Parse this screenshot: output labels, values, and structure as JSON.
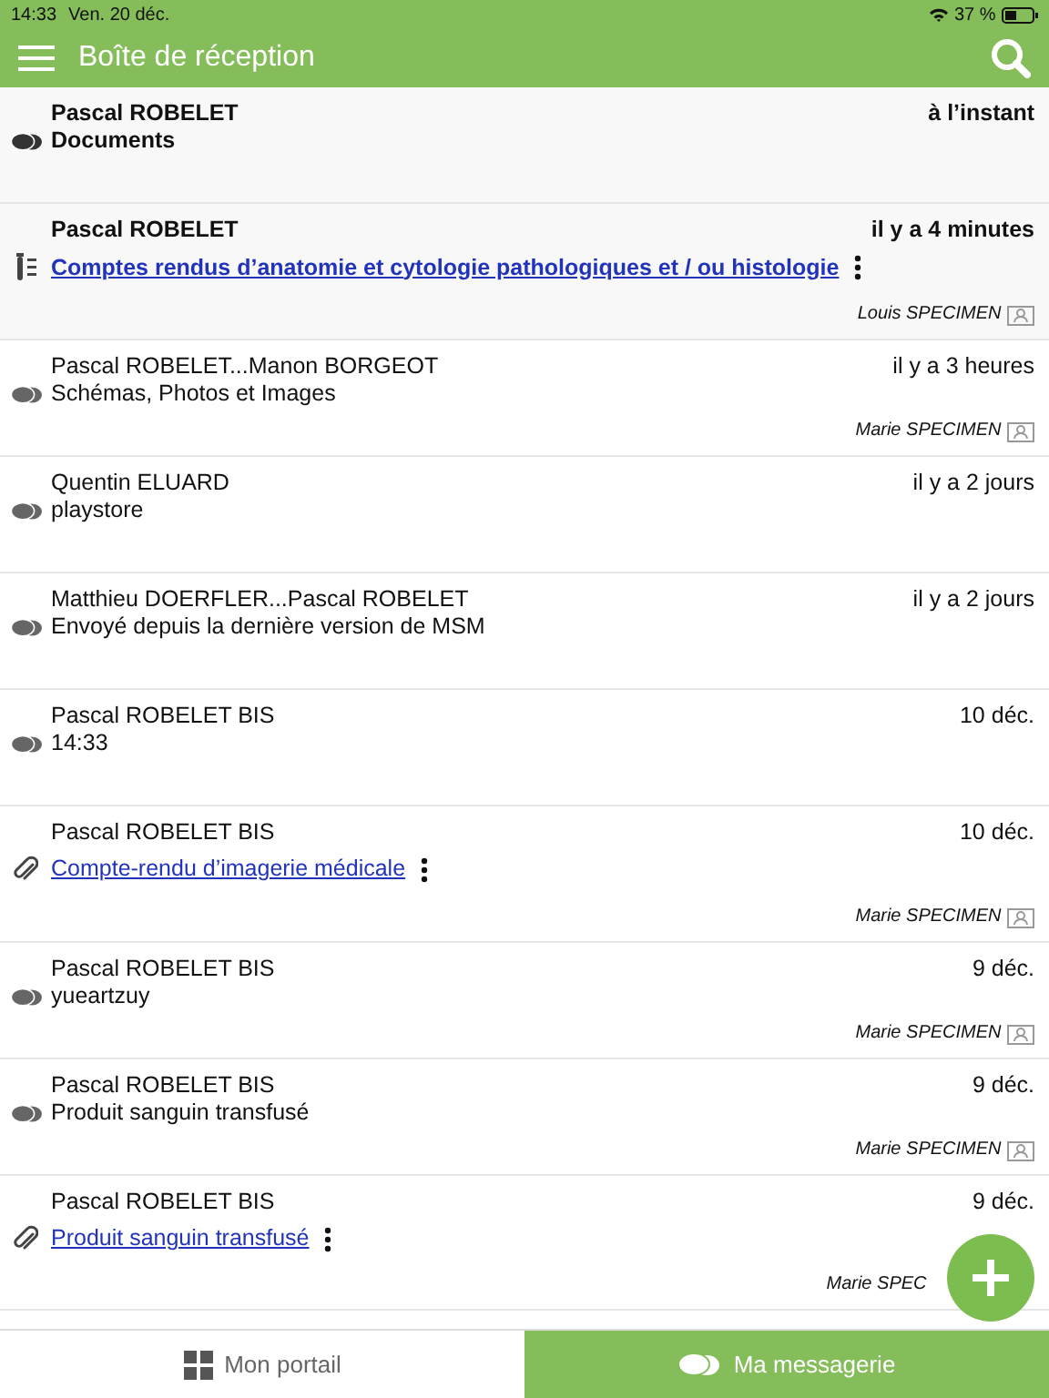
{
  "status_bar": {
    "time": "14:33",
    "date": "Ven. 20 déc.",
    "battery": "37 %"
  },
  "header": {
    "title": "Boîte de réception"
  },
  "messages": [
    {
      "kind": "message",
      "unread": true,
      "sender": "Pascal ROBELET",
      "time": "à l’instant",
      "subject": "Documents"
    },
    {
      "kind": "lab_report",
      "unread": true,
      "sender": "Pascal ROBELET",
      "time": "il y a 4 minutes",
      "subject": "Comptes rendus d’anatomie et cytologie pathologiques et / ou histologie",
      "patient": "Louis SPECIMEN",
      "patient_card": true
    },
    {
      "kind": "message",
      "unread": false,
      "sender": "Pascal ROBELET...Manon BORGEOT",
      "time": "il y a 3 heures",
      "subject": "Schémas, Photos et Images",
      "patient": "Marie SPECIMEN",
      "patient_card": true
    },
    {
      "kind": "message",
      "unread": false,
      "sender": "Quentin ELUARD",
      "time": "il y a 2 jours",
      "subject": "playstore"
    },
    {
      "kind": "message",
      "unread": false,
      "sender": "Matthieu DOERFLER...Pascal ROBELET",
      "time": "il y a 2 jours",
      "subject": "Envoyé depuis la dernière version de MSM"
    },
    {
      "kind": "message",
      "unread": false,
      "sender": "Pascal ROBELET BIS",
      "time": "10 déc.",
      "subject": "14:33"
    },
    {
      "kind": "document",
      "unread": false,
      "sender": "Pascal ROBELET BIS",
      "time": "10 déc.",
      "subject": "Compte-rendu d’imagerie médicale",
      "patient": "Marie SPECIMEN",
      "patient_card": true
    },
    {
      "kind": "message",
      "unread": false,
      "sender": "Pascal ROBELET BIS",
      "time": "9 déc.",
      "subject": "yueartzuy",
      "patient": "Marie SPECIMEN",
      "patient_card": true
    },
    {
      "kind": "message",
      "unread": false,
      "sender": "Pascal ROBELET BIS",
      "time": "9 déc.",
      "subject": "Produit sanguin transfusé",
      "patient": "Marie SPECIMEN",
      "patient_card": true
    },
    {
      "kind": "document",
      "unread": false,
      "sender": "Pascal ROBELET BIS",
      "time": "9 déc.",
      "subject": "Produit sanguin transfusé",
      "patient": "Marie SPEC",
      "patient_card": false
    }
  ],
  "tabs": [
    {
      "label": "Mon portail",
      "selected": false
    },
    {
      "label": "Ma messagerie",
      "selected": true
    }
  ]
}
